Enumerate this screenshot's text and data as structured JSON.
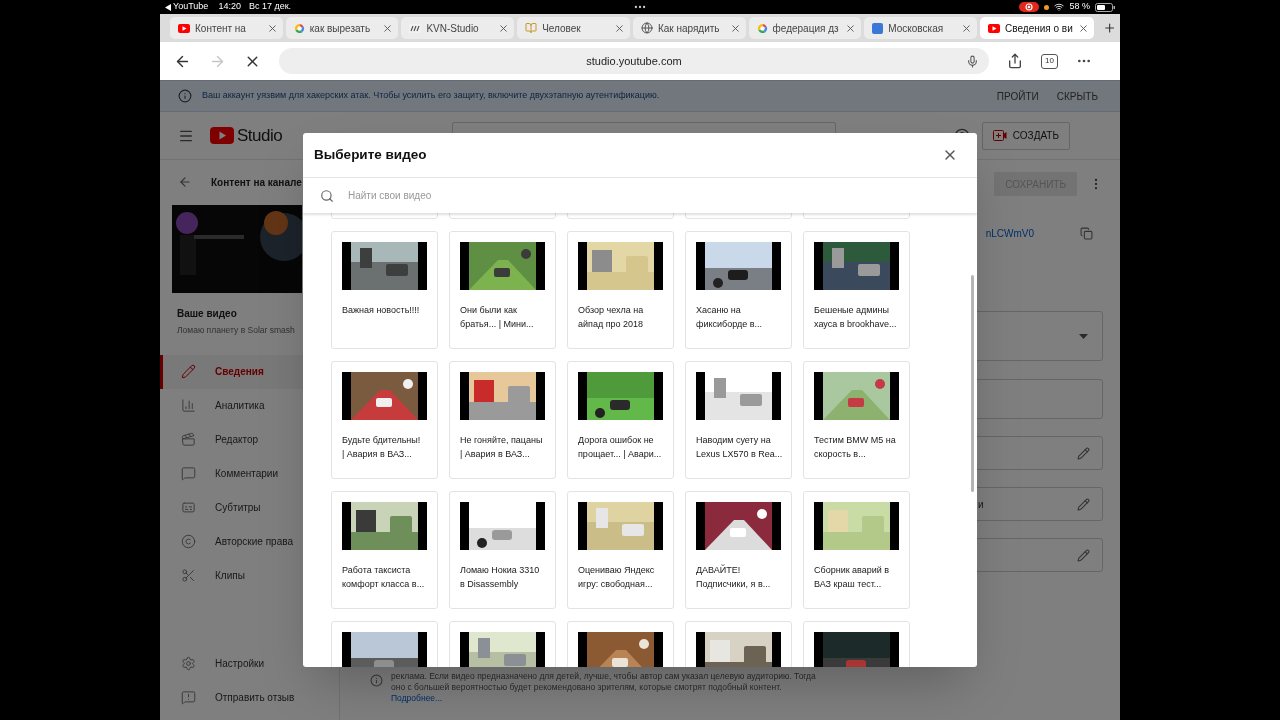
{
  "status_bar": {
    "app": "YouTube",
    "time": "14:20",
    "date": "Вс 17 дек.",
    "battery": "58 %"
  },
  "browser": {
    "tabs": [
      {
        "title": "Контент на",
        "kind": "youtube",
        "selected": false
      },
      {
        "title": "как вырезать",
        "kind": "google",
        "selected": false
      },
      {
        "title": "KVN-Studio",
        "kind": "kvn",
        "selected": false
      },
      {
        "title": "Человек",
        "kind": "book",
        "selected": false
      },
      {
        "title": "Как нарядить",
        "kind": "globe",
        "selected": false
      },
      {
        "title": "федерация дз",
        "kind": "google",
        "selected": false
      },
      {
        "title": "Московская",
        "kind": "m",
        "selected": false
      },
      {
        "title": "Сведения о ви",
        "kind": "youtube",
        "selected": true
      }
    ],
    "url": "studio.youtube.com",
    "tab_count": "10"
  },
  "banner": {
    "text": "Ваш аккаунт уязвим для хакерских атак. Чтобы усилить его защиту, включите двухэтапную аутентификацию.",
    "actions": [
      "ПРОЙТИ",
      "СКРЫТЬ"
    ]
  },
  "studio_header": {
    "logo": "Studio",
    "create": "СОЗДАТЬ"
  },
  "sidebar": {
    "back_label": "Контент на канале",
    "section_title": "Ваше видео",
    "video_title": "Ломаю планету в Solar smash",
    "items": [
      {
        "label": "Сведения",
        "kind": "pencil",
        "selected": true
      },
      {
        "label": "Аналитика",
        "kind": "chart",
        "selected": false
      },
      {
        "label": "Редактор",
        "kind": "clapper",
        "selected": false
      },
      {
        "label": "Комментарии",
        "kind": "comment",
        "selected": false
      },
      {
        "label": "Субтитры",
        "kind": "captions",
        "selected": false
      },
      {
        "label": "Авторские права",
        "kind": "copyright",
        "selected": false
      },
      {
        "label": "Клипы",
        "kind": "scissors",
        "selected": false
      }
    ],
    "footer_items": [
      {
        "label": "Настройки",
        "kind": "gear"
      },
      {
        "label": "Отправить отзыв",
        "kind": "feedback"
      }
    ]
  },
  "main": {
    "save_button": "СОХРАНИТЬ",
    "link": "nLCWmV0",
    "field_text": "и",
    "notice_lines": [
      "реклама. Если видео предназначено для детей, лучше, чтобы автор сам указал целевую аудиторию. Тогда",
      "оно с большей вероятностью будет рекомендовано зрителям, которые смотрят подобный контент."
    ],
    "more_link": "Подробнее..."
  },
  "dialog": {
    "title": "Выберите видео",
    "search_placeholder": "Найти свои видео",
    "videos": [
      {
        "kind": "cut_top"
      },
      {
        "kind": "cut_top"
      },
      {
        "kind": "cut_top"
      },
      {
        "kind": "cut_top"
      },
      {
        "kind": "cut_top"
      },
      {
        "kind": "full",
        "title_lines": [
          "Важная новость!!!!"
        ]
      },
      {
        "kind": "full",
        "title_lines": [
          "Они были как",
          "братья... | Мини..."
        ]
      },
      {
        "kind": "full",
        "title_lines": [
          "Обзор чехла на",
          "айпад про 2018"
        ]
      },
      {
        "kind": "full",
        "title_lines": [
          "Хасаню на",
          "фиксиборде в..."
        ]
      },
      {
        "kind": "full",
        "title_lines": [
          "Бешеные админы",
          "хауса в brookhave..."
        ]
      },
      {
        "kind": "full",
        "title_lines": [
          "Будьте бдительны!",
          "| Авария в ВАЗ..."
        ]
      },
      {
        "kind": "full",
        "title_lines": [
          "Не гоняйте, пацаны",
          "| Авария в ВАЗ..."
        ]
      },
      {
        "kind": "full",
        "title_lines": [
          "Дорога ошибок не",
          "прощает... | Авари..."
        ]
      },
      {
        "kind": "full",
        "title_lines": [
          "Наводим суету на",
          "Lexus LX570 в Rea..."
        ]
      },
      {
        "kind": "full",
        "title_lines": [
          "Тестим BMW M5 на",
          "скорость в..."
        ]
      },
      {
        "kind": "full",
        "title_lines": [
          "Работа таксиста",
          "комфорт класса в..."
        ]
      },
      {
        "kind": "full",
        "title_lines": [
          "Ломаю Нокиа 3310",
          "в Disassembly"
        ]
      },
      {
        "kind": "full",
        "title_lines": [
          "Оцениваю Яндекс",
          "игру: свободная..."
        ]
      },
      {
        "kind": "full",
        "title_lines": [
          "ДАВАЙТЕ!",
          "Подписчики, я в..."
        ]
      },
      {
        "kind": "full",
        "title_lines": [
          "Сборник аварий в",
          "ВАЗ краш тест..."
        ]
      },
      {
        "kind": "cut_bottom"
      },
      {
        "kind": "cut_bottom"
      },
      {
        "kind": "cut_bottom"
      },
      {
        "kind": "cut_bottom"
      },
      {
        "kind": "cut_bottom"
      }
    ]
  }
}
